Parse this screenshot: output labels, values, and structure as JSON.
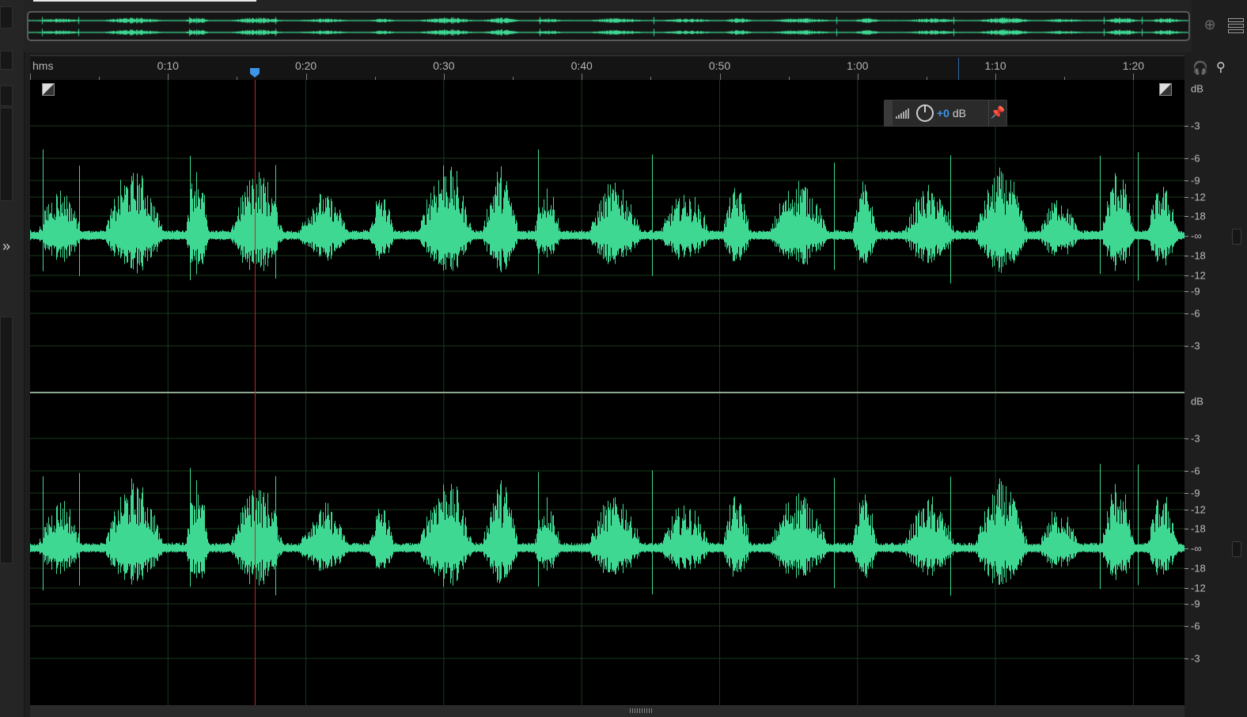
{
  "ruler": {
    "unit_label": "hms",
    "ticks": [
      "0:10",
      "0:20",
      "0:30",
      "0:40",
      "0:50",
      "1:00",
      "1:10",
      "1:20"
    ]
  },
  "amplitude_hud": {
    "value": "+0",
    "unit": " dB"
  },
  "db_scale": {
    "header": "dB",
    "labels": [
      "-3",
      "-6",
      "-9",
      "-12",
      "-18",
      "-∞",
      "-18",
      "-12",
      "-9",
      "-6",
      "-3"
    ]
  },
  "colors": {
    "waveform": "#3fd893",
    "playhead": "#c8241e",
    "accent": "#3d95e8",
    "grid": "#1a3a1a"
  },
  "icons": {
    "expand": "double-chevron-right-icon",
    "headphones": "headphones-icon",
    "pin": "pin-icon",
    "zoom_nav": "zoom-navigator-icon",
    "panel_menu": "panel-menu-icon",
    "level_meter": "level-meter-icon",
    "knob": "volume-knob-icon"
  }
}
